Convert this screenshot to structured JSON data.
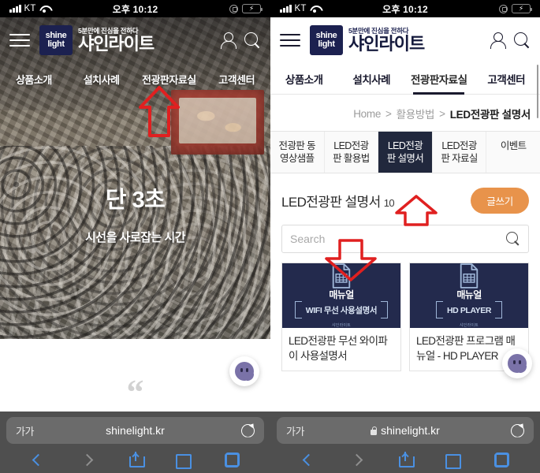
{
  "status_bar": {
    "carrier": "KT",
    "time": "오후 10:12",
    "signal_icon": "cellular-bars-icon",
    "wifi_icon": "wifi-icon",
    "rotation_lock_icon": "rotation-lock-icon",
    "battery_icon": "battery-charging-icon"
  },
  "site_header": {
    "menu_icon": "hamburger-menu-icon",
    "logo_line1": "shine",
    "logo_line2": "light",
    "tagline": "5분만에 진심을 전하다",
    "brand": "샤인라이트",
    "account_icon": "user-icon",
    "search_icon": "search-icon"
  },
  "main_nav": {
    "items": [
      {
        "label": "상품소개",
        "active": false
      },
      {
        "label": "설치사례",
        "active": false
      },
      {
        "label": "전광판자료실",
        "active": true
      },
      {
        "label": "고객센터",
        "active": false
      }
    ]
  },
  "left_phone": {
    "hero": {
      "headline": "단 3초",
      "subline": "시선을 사로잡는 시간"
    },
    "quote_mark": "“",
    "chat_icon": "chat-bubble-icon"
  },
  "right_phone": {
    "breadcrumb": {
      "home": "Home",
      "sep1": ">",
      "section": "활용방법",
      "sep2": ">",
      "current": "LED전광판 설명서"
    },
    "subtabs": [
      {
        "line1": "전광판 동",
        "line2": "영상샘플",
        "active": false
      },
      {
        "line1": "LED전광",
        "line2": "판 활용법",
        "active": false
      },
      {
        "line1": "LED전광",
        "line2": "판 설명서",
        "active": true
      },
      {
        "line1": "LED전광",
        "line2": "판 자료실",
        "active": false
      },
      {
        "line1": "이벤트",
        "line2": "",
        "active": false
      }
    ],
    "board": {
      "title": "LED전광판 설명서",
      "count": "10",
      "write_button": "글쓰기"
    },
    "search": {
      "placeholder": "Search",
      "value": "",
      "icon": "search-icon"
    },
    "cards": [
      {
        "thumb_icon": "document-table-icon",
        "thumb_label": "매뉴얼",
        "thumb_sub": "WIFI 무선 사용설명서",
        "thumb_foot": "샤인라이트",
        "caption": "LED전광판 무선 와이파이 사용설명서"
      },
      {
        "thumb_icon": "document-table-icon",
        "thumb_label": "매뉴얼",
        "thumb_sub": "HD PLAYER",
        "thumb_foot": "샤인라이트",
        "caption": "LED전광판 프로그램 매뉴얼 - HD PLAYER"
      }
    ],
    "chat_icon": "chat-bubble-icon",
    "scrollbar": "vertical-scrollbar"
  },
  "browser_chrome": {
    "aa_button": "가가",
    "url_left": "shinelight.kr",
    "url_right": "shinelight.kr",
    "lock_icon": "lock-icon",
    "reload_icon": "reload-icon",
    "back_icon": "chevron-left-icon",
    "forward_icon": "chevron-right-icon",
    "share_icon": "share-icon",
    "bookmarks_icon": "book-icon",
    "tabs_icon": "tabs-icon"
  },
  "annotations": {
    "color": "#e02020",
    "arrows": [
      {
        "name": "arrow-to-board-menu",
        "direction": "up"
      },
      {
        "name": "arrow-to-subtab-manual",
        "direction": "up"
      },
      {
        "name": "arrow-to-search-field",
        "direction": "down"
      }
    ]
  }
}
